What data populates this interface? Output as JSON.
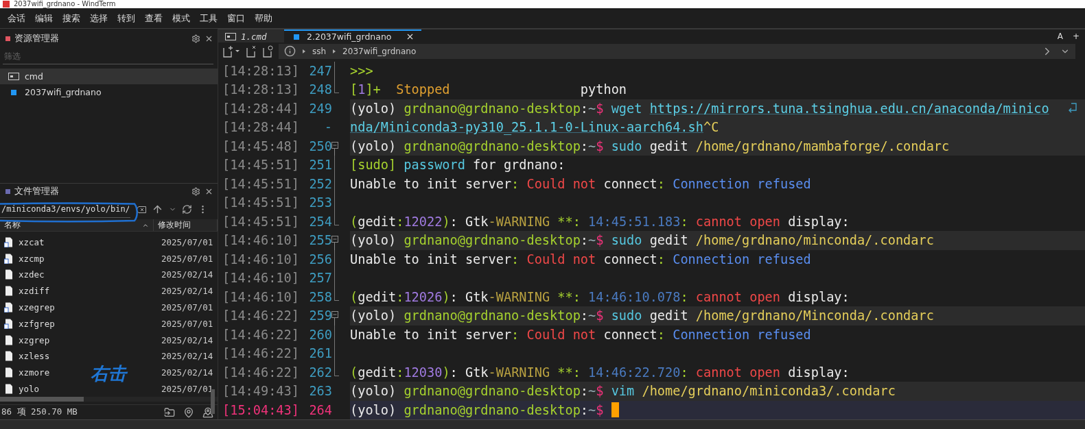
{
  "window": {
    "title": "2037wifi_grdnano - WindTerm"
  },
  "menu": [
    "会话",
    "编辑",
    "搜索",
    "选择",
    "转到",
    "查看",
    "模式",
    "工具",
    "窗口",
    "帮助"
  ],
  "explorer": {
    "title": "资源管理器",
    "filter_placeholder": "筛选",
    "sessions": [
      {
        "label": "cmd",
        "kind": "cmd",
        "selected": true
      },
      {
        "label": "2037wifi_grdnano",
        "kind": "ssh",
        "selected": false
      }
    ]
  },
  "file_manager": {
    "title": "文件管理器",
    "path": "/miniconda3/envs/yolo/bin/",
    "columns": [
      "名称",
      "修改时间"
    ],
    "files": [
      {
        "name": "xzcat",
        "kind": "link",
        "modified": "2025/07/01"
      },
      {
        "name": "xzcmp",
        "kind": "link",
        "modified": "2025/07/01"
      },
      {
        "name": "xzdec",
        "kind": "plain",
        "modified": "2025/02/14"
      },
      {
        "name": "xzdiff",
        "kind": "plain",
        "modified": "2025/02/14"
      },
      {
        "name": "xzegrep",
        "kind": "link",
        "modified": "2025/07/01"
      },
      {
        "name": "xzfgrep",
        "kind": "link",
        "modified": "2025/07/01"
      },
      {
        "name": "xzgrep",
        "kind": "plain",
        "modified": "2025/02/14"
      },
      {
        "name": "xzless",
        "kind": "plain",
        "modified": "2025/02/14"
      },
      {
        "name": "xzmore",
        "kind": "plain",
        "modified": "2025/02/14"
      },
      {
        "name": "yolo",
        "kind": "plain",
        "modified": "2025/07/01"
      }
    ],
    "annotation": "右击",
    "status": "86 项 250.70 MB"
  },
  "tabs": [
    {
      "label": "1.cmd",
      "kind": "cmd",
      "selected": false
    },
    {
      "label": "2.2037wifi_grdnano",
      "kind": "ssh",
      "selected": true
    }
  ],
  "tab_bar_buttons": [
    "A",
    "+"
  ],
  "breadcrumb": [
    "ssh",
    "2037wifi_grdnano"
  ],
  "terminal": {
    "lines": [
      {
        "time": "[14:28:13]",
        "number": "247",
        "fold_start": false,
        "in_fold": true,
        "fold_end": false,
        "highlighted": false,
        "current": false,
        "wrapped": false,
        "segments": [
          {
            "text": ">>>",
            "color": "#a6d22e"
          }
        ]
      },
      {
        "time": "[14:28:13]",
        "number": "248",
        "fold_start": false,
        "in_fold": true,
        "fold_end": true,
        "highlighted": false,
        "current": false,
        "wrapped": false,
        "segments": [
          {
            "text": "[",
            "color": "#a6d22e"
          },
          {
            "text": "1",
            "color": "#a07ae0"
          },
          {
            "text": "]+",
            "color": "#a6d22e"
          },
          {
            "text": "  Stopped",
            "color": "#e0a030"
          },
          {
            "text": "                 python",
            "color": "#eaeaea"
          }
        ]
      },
      {
        "time": "[14:28:44]",
        "number": "249",
        "fold_start": false,
        "in_fold": false,
        "fold_end": false,
        "highlighted": true,
        "current": false,
        "wrapped": true,
        "segments": [
          {
            "text": "(yolo) ",
            "color": "#eaeaea"
          },
          {
            "text": "grdnano@grdnano-desktop",
            "color": "#a6d22e"
          },
          {
            "text": ":",
            "color": "#eaeaea"
          },
          {
            "text": "~",
            "color": "#9ab0b8"
          },
          {
            "text": "$",
            "color": "#f0327a"
          },
          {
            "text": " wget ",
            "color": "#56c8e0"
          },
          {
            "text": "https://mirrors.tuna.tsinghua.edu.cn/anaconda/minico",
            "color": "#5ccfe6",
            "link": true
          }
        ]
      },
      {
        "time": "[14:28:44]",
        "number": "-",
        "fold_start": false,
        "in_fold": false,
        "fold_end": false,
        "highlighted": true,
        "current": false,
        "wrapped": false,
        "segments": [
          {
            "text": "nda/Miniconda3-py310_25.1.1-0-Linux-aarch64.sh",
            "color": "#5ccfe6",
            "link": true
          },
          {
            "text": "^C",
            "color": "#e6cf5a"
          }
        ]
      },
      {
        "time": "[14:45:48]",
        "number": "250",
        "fold_start": true,
        "in_fold": false,
        "fold_end": false,
        "highlighted": true,
        "current": false,
        "wrapped": false,
        "segments": [
          {
            "text": "(yolo) ",
            "color": "#eaeaea"
          },
          {
            "text": "grdnano@grdnano-desktop",
            "color": "#a6d22e"
          },
          {
            "text": ":",
            "color": "#eaeaea"
          },
          {
            "text": "~",
            "color": "#9ab0b8"
          },
          {
            "text": "$",
            "color": "#f0327a"
          },
          {
            "text": " sudo",
            "color": "#56c8e0"
          },
          {
            "text": " gedit ",
            "color": "#eaeaea"
          },
          {
            "text": "/home/grdnano/mambaforge/.condarc",
            "color": "#e6cf5a"
          }
        ]
      },
      {
        "time": "[14:45:51]",
        "number": "251",
        "fold_start": false,
        "in_fold": true,
        "fold_end": false,
        "highlighted": false,
        "current": false,
        "wrapped": false,
        "segments": [
          {
            "text": "[sudo]",
            "color": "#a6d22e"
          },
          {
            "text": " password",
            "color": "#56c8e0"
          },
          {
            "text": " for grdnano:",
            "color": "#eaeaea"
          }
        ]
      },
      {
        "time": "[14:45:51]",
        "number": "252",
        "fold_start": false,
        "in_fold": true,
        "fold_end": false,
        "highlighted": false,
        "current": false,
        "wrapped": false,
        "segments": [
          {
            "text": "Unable to init server",
            "color": "#eaeaea"
          },
          {
            "text": ":",
            "color": "#a6d22e"
          },
          {
            "text": " Could not",
            "color": "#f04848"
          },
          {
            "text": " connect",
            "color": "#eaeaea"
          },
          {
            "text": ":",
            "color": "#a6d22e"
          },
          {
            "text": " Connection refused",
            "color": "#5a8ef0"
          }
        ]
      },
      {
        "time": "[14:45:51]",
        "number": "253",
        "fold_start": false,
        "in_fold": true,
        "fold_end": false,
        "highlighted": false,
        "current": false,
        "wrapped": false
      },
      {
        "time": "[14:45:51]",
        "number": "254",
        "fold_start": false,
        "in_fold": true,
        "fold_end": true,
        "highlighted": false,
        "current": false,
        "wrapped": false,
        "segments": [
          {
            "text": "(",
            "color": "#a6d22e"
          },
          {
            "text": "gedit",
            "color": "#eaeaea"
          },
          {
            "text": ":",
            "color": "#a6d22e"
          },
          {
            "text": "12022",
            "color": "#a07ae0"
          },
          {
            "text": ")",
            "color": "#a6d22e"
          },
          {
            "text": ": Gtk",
            "color": "#eaeaea"
          },
          {
            "text": "-WARNING",
            "color": "#b8a040"
          },
          {
            "text": " **:",
            "color": "#a6d22e"
          },
          {
            "text": " 14:45:51.183",
            "color": "#4a7ac0"
          },
          {
            "text": ":",
            "color": "#a6d22e"
          },
          {
            "text": " cannot open",
            "color": "#f04848"
          },
          {
            "text": " display:",
            "color": "#eaeaea"
          }
        ]
      },
      {
        "time": "[14:46:10]",
        "number": "255",
        "fold_start": true,
        "in_fold": false,
        "fold_end": false,
        "highlighted": true,
        "current": false,
        "wrapped": false,
        "segments": [
          {
            "text": "(yolo) ",
            "color": "#eaeaea"
          },
          {
            "text": "grdnano@grdnano-desktop",
            "color": "#a6d22e"
          },
          {
            "text": ":",
            "color": "#eaeaea"
          },
          {
            "text": "~",
            "color": "#9ab0b8"
          },
          {
            "text": "$",
            "color": "#f0327a"
          },
          {
            "text": " sudo",
            "color": "#56c8e0"
          },
          {
            "text": " gedit ",
            "color": "#eaeaea"
          },
          {
            "text": "/home/grdnano/minconda/.condarc",
            "color": "#e6cf5a"
          }
        ]
      },
      {
        "time": "[14:46:10]",
        "number": "256",
        "fold_start": false,
        "in_fold": true,
        "fold_end": false,
        "highlighted": false,
        "current": false,
        "wrapped": false,
        "segments": [
          {
            "text": "Unable to init server",
            "color": "#eaeaea"
          },
          {
            "text": ":",
            "color": "#a6d22e"
          },
          {
            "text": " Could not",
            "color": "#f04848"
          },
          {
            "text": " connect",
            "color": "#eaeaea"
          },
          {
            "text": ":",
            "color": "#a6d22e"
          },
          {
            "text": " Connection refused",
            "color": "#5a8ef0"
          }
        ]
      },
      {
        "time": "[14:46:10]",
        "number": "257",
        "fold_start": false,
        "in_fold": true,
        "fold_end": false,
        "highlighted": false,
        "current": false,
        "wrapped": false
      },
      {
        "time": "[14:46:10]",
        "number": "258",
        "fold_start": false,
        "in_fold": true,
        "fold_end": true,
        "highlighted": false,
        "current": false,
        "wrapped": false,
        "segments": [
          {
            "text": "(",
            "color": "#a6d22e"
          },
          {
            "text": "gedit",
            "color": "#eaeaea"
          },
          {
            "text": ":",
            "color": "#a6d22e"
          },
          {
            "text": "12026",
            "color": "#a07ae0"
          },
          {
            "text": ")",
            "color": "#a6d22e"
          },
          {
            "text": ": Gtk",
            "color": "#eaeaea"
          },
          {
            "text": "-WARNING",
            "color": "#b8a040"
          },
          {
            "text": " **:",
            "color": "#a6d22e"
          },
          {
            "text": " 14:46:10.078",
            "color": "#4a7ac0"
          },
          {
            "text": ":",
            "color": "#a6d22e"
          },
          {
            "text": " cannot open",
            "color": "#f04848"
          },
          {
            "text": " display:",
            "color": "#eaeaea"
          }
        ]
      },
      {
        "time": "[14:46:22]",
        "number": "259",
        "fold_start": true,
        "in_fold": false,
        "fold_end": false,
        "highlighted": true,
        "current": false,
        "wrapped": false,
        "segments": [
          {
            "text": "(yolo) ",
            "color": "#eaeaea"
          },
          {
            "text": "grdnano@grdnano-desktop",
            "color": "#a6d22e"
          },
          {
            "text": ":",
            "color": "#eaeaea"
          },
          {
            "text": "~",
            "color": "#9ab0b8"
          },
          {
            "text": "$",
            "color": "#f0327a"
          },
          {
            "text": " sudo",
            "color": "#56c8e0"
          },
          {
            "text": " gedit ",
            "color": "#eaeaea"
          },
          {
            "text": "/home/grdnano/Minconda/.condarc",
            "color": "#e6cf5a"
          }
        ]
      },
      {
        "time": "[14:46:22]",
        "number": "260",
        "fold_start": false,
        "in_fold": true,
        "fold_end": false,
        "highlighted": false,
        "current": false,
        "wrapped": false,
        "segments": [
          {
            "text": "Unable to init server",
            "color": "#eaeaea"
          },
          {
            "text": ":",
            "color": "#a6d22e"
          },
          {
            "text": " Could not",
            "color": "#f04848"
          },
          {
            "text": " connect",
            "color": "#eaeaea"
          },
          {
            "text": ":",
            "color": "#a6d22e"
          },
          {
            "text": " Connection refused",
            "color": "#5a8ef0"
          }
        ]
      },
      {
        "time": "[14:46:22]",
        "number": "261",
        "fold_start": false,
        "in_fold": true,
        "fold_end": false,
        "highlighted": false,
        "current": false,
        "wrapped": false
      },
      {
        "time": "[14:46:22]",
        "number": "262",
        "fold_start": false,
        "in_fold": true,
        "fold_end": true,
        "highlighted": false,
        "current": false,
        "wrapped": false,
        "segments": [
          {
            "text": "(",
            "color": "#a6d22e"
          },
          {
            "text": "gedit",
            "color": "#eaeaea"
          },
          {
            "text": ":",
            "color": "#a6d22e"
          },
          {
            "text": "12030",
            "color": "#a07ae0"
          },
          {
            "text": ")",
            "color": "#a6d22e"
          },
          {
            "text": ": Gtk",
            "color": "#eaeaea"
          },
          {
            "text": "-WARNING",
            "color": "#b8a040"
          },
          {
            "text": " **:",
            "color": "#a6d22e"
          },
          {
            "text": " 14:46:22.720",
            "color": "#4a7ac0"
          },
          {
            "text": ":",
            "color": "#a6d22e"
          },
          {
            "text": " cannot open",
            "color": "#f04848"
          },
          {
            "text": " display:",
            "color": "#eaeaea"
          }
        ]
      },
      {
        "time": "[14:49:43]",
        "number": "263",
        "fold_start": false,
        "in_fold": false,
        "fold_end": false,
        "highlighted": true,
        "current": false,
        "wrapped": false,
        "segments": [
          {
            "text": "(yolo) ",
            "color": "#eaeaea"
          },
          {
            "text": "grdnano@grdnano-desktop",
            "color": "#a6d22e"
          },
          {
            "text": ":",
            "color": "#eaeaea"
          },
          {
            "text": "~",
            "color": "#9ab0b8"
          },
          {
            "text": "$",
            "color": "#f0327a"
          },
          {
            "text": " vim ",
            "color": "#56c8e0"
          },
          {
            "text": "/home/grdnano/miniconda3/.condarc",
            "color": "#e6cf5a"
          }
        ]
      },
      {
        "time": "[15:04:43]",
        "number": "264",
        "fold_start": false,
        "in_fold": false,
        "fold_end": false,
        "highlighted": false,
        "current": true,
        "wrapped": false,
        "segments": [
          {
            "text": "(yolo) ",
            "color": "#eaeaea"
          },
          {
            "text": "grdnano@grdnano-desktop",
            "color": "#a6d22e"
          },
          {
            "text": ":",
            "color": "#eaeaea"
          },
          {
            "text": "~",
            "color": "#9ab0b8"
          },
          {
            "text": "$",
            "color": "#f0327a"
          }
        ]
      }
    ]
  }
}
